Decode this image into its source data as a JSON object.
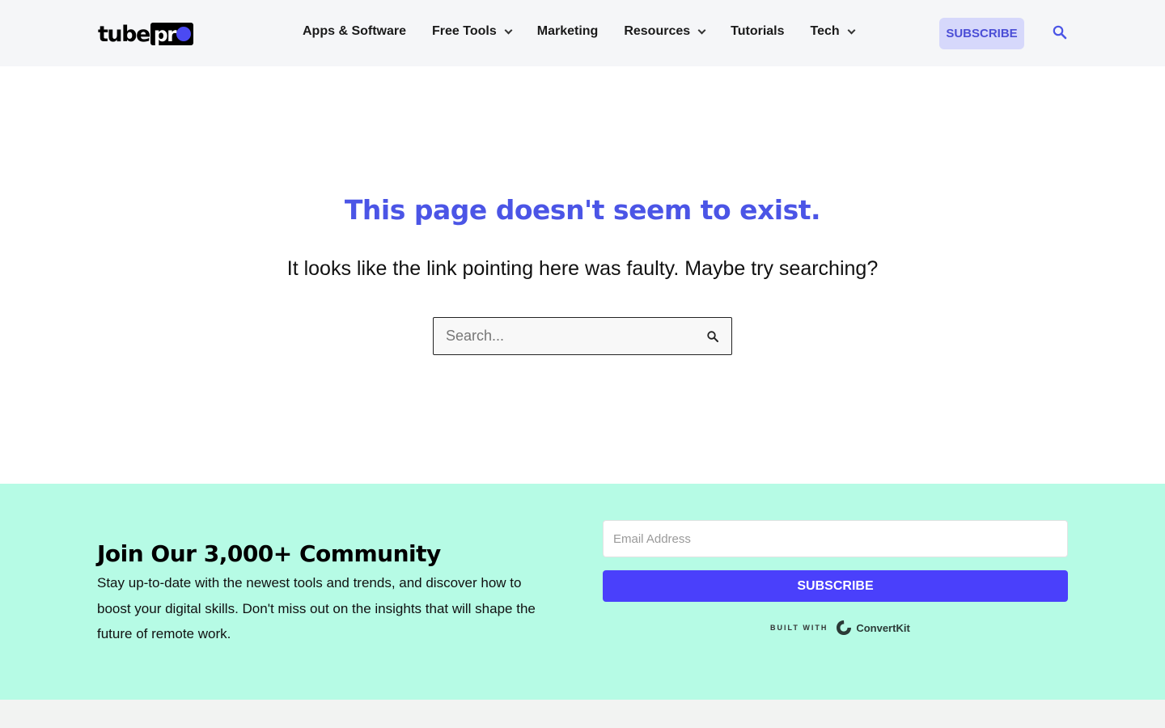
{
  "header": {
    "logo": {
      "part1": "tube",
      "part2": "pr"
    },
    "nav": [
      {
        "label": "Apps & Software",
        "has_dropdown": false
      },
      {
        "label": "Free Tools",
        "has_dropdown": true
      },
      {
        "label": "Marketing",
        "has_dropdown": false
      },
      {
        "label": "Resources",
        "has_dropdown": true
      },
      {
        "label": "Tutorials",
        "has_dropdown": false
      },
      {
        "label": "Tech",
        "has_dropdown": true
      }
    ],
    "subscribe_label": "SUBSCRIBE",
    "search_icon": "search-icon"
  },
  "main": {
    "title": "This page doesn't seem to exist.",
    "subtitle": "It looks like the link pointing here was faulty. Maybe try searching?",
    "search": {
      "placeholder": "Search...",
      "value": ""
    }
  },
  "newsletter": {
    "title": "Join Our 3,000+ Community",
    "text": "Stay up-to-date with the newest tools and trends, and discover how to boost your digital skills. Don't miss out on the insights that will shape the future of remote work.",
    "email_placeholder": "Email Address",
    "button_label": "SUBSCRIBE",
    "built_with_label": "BUILT WITH",
    "provider": "ConvertKit"
  },
  "colors": {
    "accent": "#4b55e6",
    "button_primary": "#4a40fb",
    "newsletter_bg": "#b6fbe5",
    "header_bg": "#f5f6f8",
    "subscribe_top_bg": "#d6d8fb"
  }
}
